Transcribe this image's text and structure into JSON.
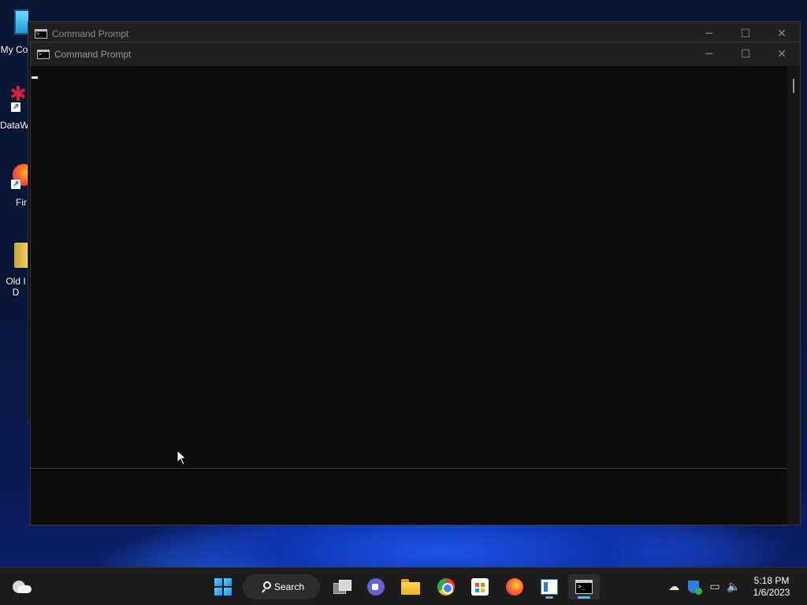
{
  "desktop": {
    "icons": [
      {
        "label": "My Co",
        "icon": "computer-icon"
      },
      {
        "label": "DataW",
        "icon": "datawarrior-icon"
      },
      {
        "label": "Fir",
        "icon": "firefox-icon"
      },
      {
        "label": "Old I\nD",
        "icon": "folder-icon"
      }
    ]
  },
  "windows": {
    "back": {
      "title": "Command Prompt",
      "controls": {
        "minimize": "─",
        "maximize": "☐",
        "close": "✕"
      }
    },
    "front": {
      "title": "Command Prompt",
      "controls": {
        "minimize": "─",
        "maximize": "☐",
        "close": "✕"
      }
    }
  },
  "taskbar": {
    "search_label": "Search",
    "apps": [
      {
        "name": "start",
        "icon": "windows-start-icon"
      },
      {
        "name": "task-view",
        "icon": "task-view-icon"
      },
      {
        "name": "teams",
        "icon": "teams-icon"
      },
      {
        "name": "file-explorer",
        "icon": "folder-icon"
      },
      {
        "name": "chrome",
        "icon": "chrome-icon"
      },
      {
        "name": "store",
        "icon": "store-icon"
      },
      {
        "name": "firefox",
        "icon": "firefox-icon"
      },
      {
        "name": "notepad",
        "icon": "notepad-icon"
      },
      {
        "name": "command-prompt",
        "icon": "terminal-icon"
      }
    ],
    "tray": [
      "onedrive-icon",
      "security-icon",
      "network-icon",
      "volume-icon"
    ],
    "clock": {
      "time": "5:18 PM",
      "date": "1/6/2023"
    }
  },
  "colors": {
    "accent": "#4cc2ff",
    "console_bg": "#0c0c0c",
    "titlebar_bg": "#202020",
    "taskbar_bg": "#1c1c1c"
  }
}
